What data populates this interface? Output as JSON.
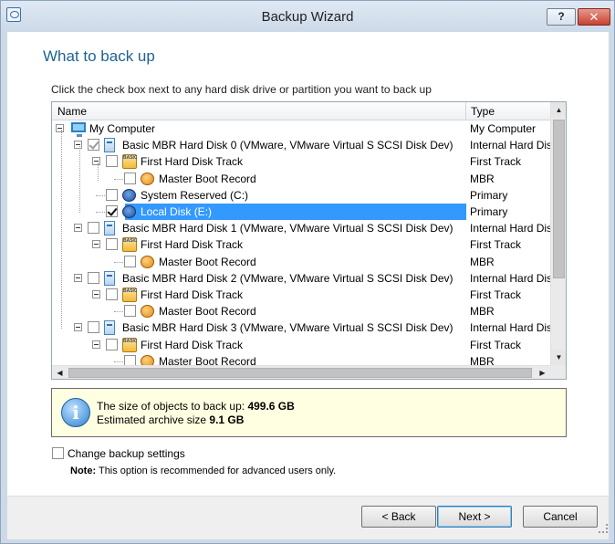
{
  "window": {
    "title": "Backup Wizard",
    "help_label": "?",
    "close_label": "✕"
  },
  "page": {
    "heading": "What to back up",
    "instruction": "Click the check box next to any hard disk drive or partition you want to back up"
  },
  "tree": {
    "columns": {
      "name": "Name",
      "type": "Type"
    },
    "rows": [
      {
        "label": "My Computer",
        "type": "My Computer",
        "level": 0,
        "checkbox": "none",
        "icon": "computer-icon"
      },
      {
        "label": "Basic MBR Hard Disk 0 (VMware, VMware Virtual S SCSI Disk Dev)",
        "type": "Internal Hard Disk",
        "level": 1,
        "checkbox": "partial",
        "icon": "hard-disk-icon"
      },
      {
        "label": "First Hard Disk Track",
        "type": "First Track",
        "level": 2,
        "checkbox": "unchecked",
        "icon": "disk-track-icon"
      },
      {
        "label": "Master Boot Record",
        "type": "MBR",
        "level": 3,
        "checkbox": "unchecked",
        "icon": "mbr-icon"
      },
      {
        "label": "System Reserved (C:)",
        "type": "Primary",
        "level": 2,
        "checkbox": "unchecked",
        "icon": "partition-icon"
      },
      {
        "label": "Local Disk (E:)",
        "type": "Primary",
        "level": 2,
        "checkbox": "checked",
        "icon": "partition-icon",
        "selected": true
      },
      {
        "label": "Basic MBR Hard Disk 1 (VMware, VMware Virtual S SCSI Disk Dev)",
        "type": "Internal Hard Disk",
        "level": 1,
        "checkbox": "unchecked",
        "icon": "hard-disk-icon"
      },
      {
        "label": "First Hard Disk Track",
        "type": "First Track",
        "level": 2,
        "checkbox": "unchecked",
        "icon": "disk-track-icon"
      },
      {
        "label": "Master Boot Record",
        "type": "MBR",
        "level": 3,
        "checkbox": "unchecked",
        "icon": "mbr-icon"
      },
      {
        "label": "Basic MBR Hard Disk 2 (VMware, VMware Virtual S SCSI Disk Dev)",
        "type": "Internal Hard Disk",
        "level": 1,
        "checkbox": "unchecked",
        "icon": "hard-disk-icon"
      },
      {
        "label": "First Hard Disk Track",
        "type": "First Track",
        "level": 2,
        "checkbox": "unchecked",
        "icon": "disk-track-icon"
      },
      {
        "label": "Master Boot Record",
        "type": "MBR",
        "level": 3,
        "checkbox": "unchecked",
        "icon": "mbr-icon"
      },
      {
        "label": "Basic MBR Hard Disk 3 (VMware, VMware Virtual S SCSI Disk Dev)",
        "type": "Internal Hard Disk",
        "level": 1,
        "checkbox": "unchecked",
        "icon": "hard-disk-icon"
      },
      {
        "label": "First Hard Disk Track",
        "type": "First Track",
        "level": 2,
        "checkbox": "unchecked",
        "icon": "disk-track-icon"
      },
      {
        "label": "Master Boot Record",
        "type": "MBR",
        "level": 3,
        "checkbox": "unchecked",
        "icon": "mbr-icon"
      }
    ]
  },
  "info": {
    "size_label": "The size of objects to back up:",
    "size_value": "499.6 GB",
    "archive_label": "Estimated archive size",
    "archive_value": "9.1 GB"
  },
  "options": {
    "change_settings_label": "Change backup settings",
    "change_settings_checked": false,
    "note_prefix": "Note:",
    "note_text": "This option is recommended for advanced users only."
  },
  "footer": {
    "back_label": "< Back",
    "next_label": "Next >",
    "cancel_label": "Cancel"
  },
  "colors": {
    "heading": "#1e6394",
    "selection": "#3399ff",
    "info_background": "#ffffe1"
  }
}
